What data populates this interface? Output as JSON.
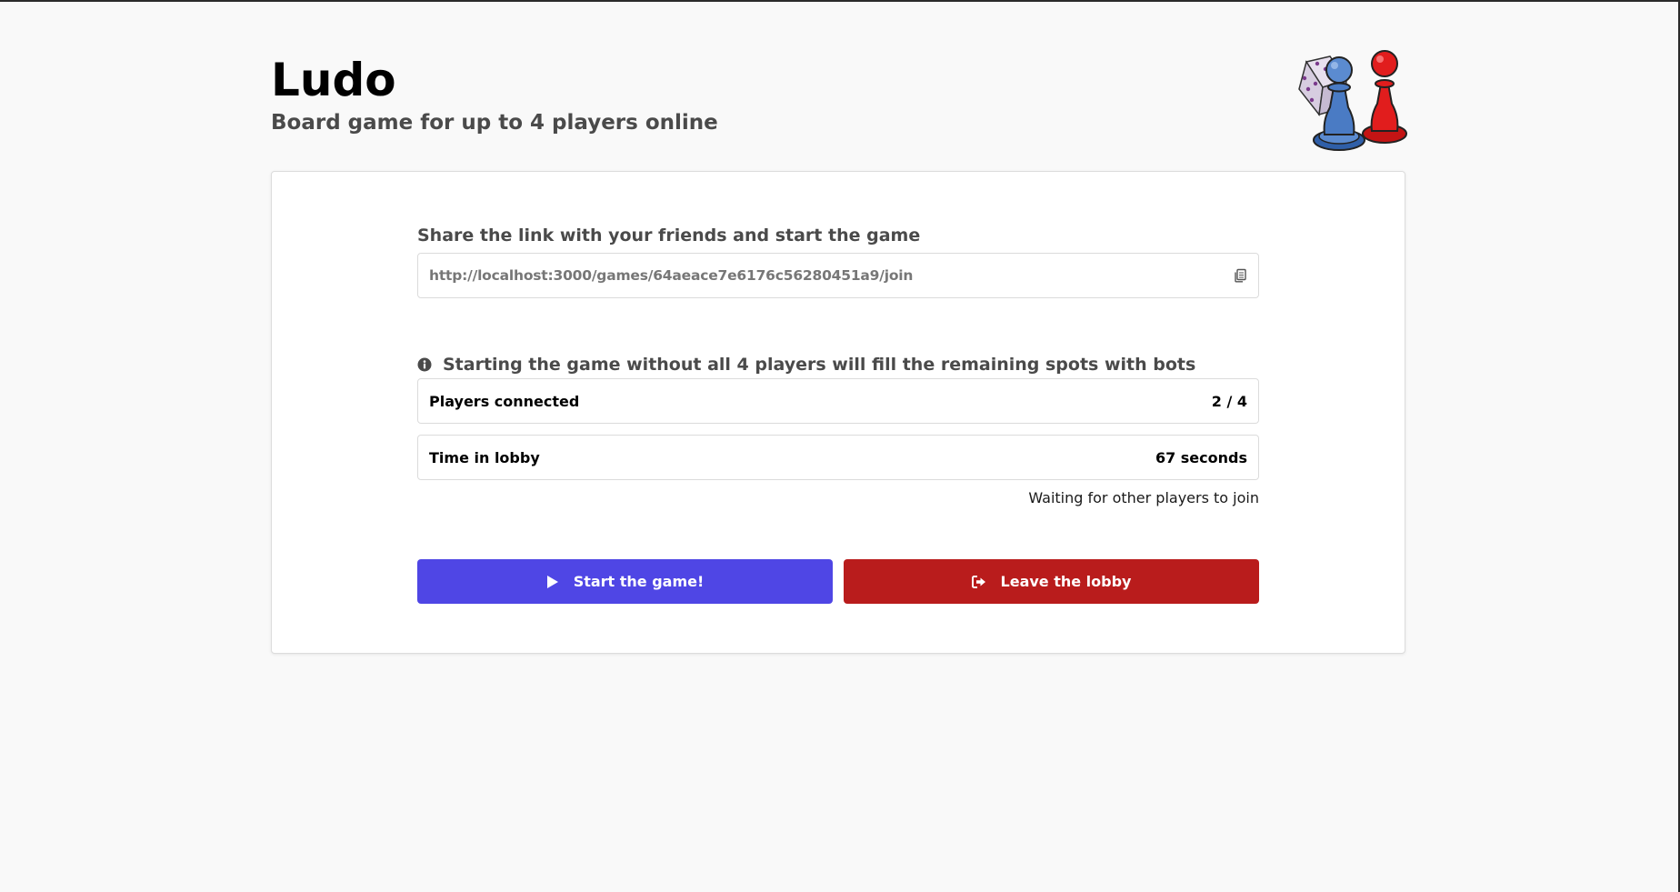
{
  "header": {
    "title": "Ludo",
    "subtitle": "Board game for up to 4 players online",
    "logo_icon": "dice-and-pawns-logo"
  },
  "share": {
    "label": "Share the link with your friends and start the game",
    "link": "http://localhost:3000/games/64aeace7e6176c56280451a9/join",
    "copy_icon": "copy-icon"
  },
  "info": {
    "icon": "info-icon",
    "text": "Starting the game without all 4 players will fill the remaining spots with bots"
  },
  "stats": {
    "players_label": "Players connected",
    "players_value": "2 / 4",
    "time_label": "Time in lobby",
    "time_value": "67 seconds",
    "status_text": "Waiting for other players to join"
  },
  "actions": {
    "start_label": "Start the game!",
    "start_icon": "play-icon",
    "leave_label": "Leave the lobby",
    "leave_icon": "sign-out-icon"
  },
  "colors": {
    "start_button": "#4f46e5",
    "leave_button": "#b91c1c",
    "background": "#f9f9f9"
  }
}
